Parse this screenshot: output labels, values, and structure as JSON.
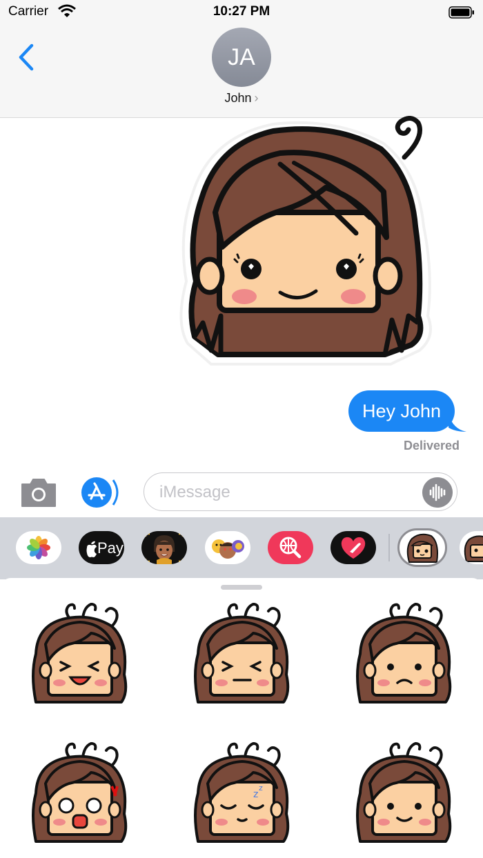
{
  "status": {
    "carrier": "Carrier",
    "time": "10:27 PM"
  },
  "header": {
    "avatar_initials": "JA",
    "contact_name": "John",
    "chevron": "›"
  },
  "conversation": {
    "message": "Hey John",
    "status": "Delivered"
  },
  "composer": {
    "placeholder": "iMessage"
  },
  "app_strip": {
    "applepay_label": "Pay"
  },
  "stickers": [
    {
      "eyes": "squint",
      "mouth": "open"
    },
    {
      "eyes": "squint",
      "mouth": "flat"
    },
    {
      "eyes": "dot",
      "mouth": "frown"
    },
    {
      "eyes": "round",
      "mouth": "shout"
    },
    {
      "eyes": "closed",
      "mouth": "small"
    },
    {
      "eyes": "dot",
      "mouth": "smile"
    }
  ],
  "colors": {
    "blue": "#1b87f5",
    "hair": "#7a4a3a",
    "skin": "#fbd0a2"
  }
}
